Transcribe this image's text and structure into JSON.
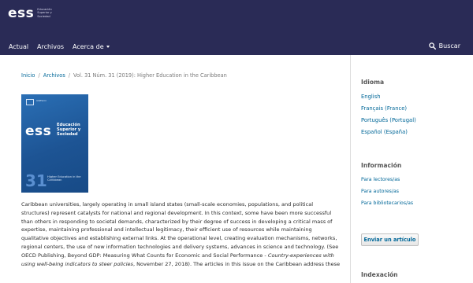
{
  "header": {
    "logo_text": "ess",
    "logo_tagline": [
      "Educación",
      "Superior y",
      "Sociedad"
    ]
  },
  "nav": {
    "items": [
      {
        "label": "Actual"
      },
      {
        "label": "Archivos"
      },
      {
        "label": "Acerca de"
      }
    ],
    "search_label": "Buscar"
  },
  "breadcrumb": {
    "home": "Inicio",
    "archives": "Archivos",
    "current": "Vol. 31 Núm. 31 (2019): Higher Education in the Caribbean",
    "separator": "/"
  },
  "cover": {
    "org": "UNESCO",
    "org_detail": "Organización de las Naciones Unidas para la Educación",
    "mark": "ess",
    "title": "Educación Superior y Sociedad",
    "number": "31",
    "subtitle": "Higher Education in the Caribbean"
  },
  "description": {
    "part1": "Caribbean universities, largely operating in small island states (small-scale economies, populations, and political structures) represent catalysts for national and regional development. In this context, some have been more successful than others in responding to societal demands, characterized by their degree of success in developing a critical mass of expertise, maintaining professional and intellectual legitimacy, their efficient use of resources while maintaining qualitative objectives and establishing external links. At the operational level, creating evaluation mechanisms, networks, regional centers, the use of new information technologies and delivery systems, advances in science and technology. (See OECD Publishing, Beyond GDP: Measuring What Counts for Economic and Social Performance - ",
    "italic": "Country-experiences with using well-being indicators to steer policies",
    "part2": ", November 27, 2018). The articles in this issue on the Caribbean address these"
  },
  "sidebar": {
    "language_heading": "Idioma",
    "languages": [
      {
        "label": "English"
      },
      {
        "label": "Français (France)"
      },
      {
        "label": "Português (Portugal)"
      },
      {
        "label": "Español (España)"
      }
    ],
    "info_heading": "Información",
    "info_links": [
      {
        "label": "Para lectores/as"
      },
      {
        "label": "Para autores/as"
      },
      {
        "label": "Para bibliotecarios/as"
      }
    ],
    "submit_label": "Enviar un artículo",
    "indexing_heading": "Indexación"
  },
  "colors": {
    "header_bg": "#2a2b56",
    "link": "#006798",
    "cover_blue": "#1f5a9d"
  }
}
